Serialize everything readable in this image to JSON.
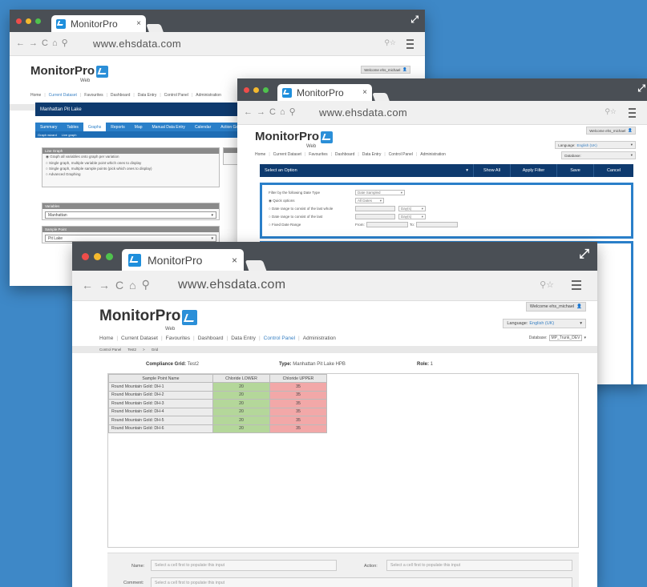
{
  "browser": {
    "tab_title": "MonitorPro",
    "url": "www.ehsdata.com",
    "close_glyph": "×"
  },
  "app": {
    "brand": "MonitorPro",
    "brand_sub": "Web",
    "welcome": "Welcome ehs_michael",
    "language_label": "Language:",
    "language_value": "English (UK)",
    "database_label": "Database:",
    "database_value": "MP_Trunk_DEV",
    "nav": [
      "Home",
      "Current Dataset",
      "Favourites",
      "Dashboard",
      "Data Entry",
      "Control Panel",
      "Administration"
    ]
  },
  "winA": {
    "header": "Manhattan Pit Lake",
    "subtabs": [
      "Summary",
      "Tables",
      "Graphs",
      "Reports",
      "Map",
      "Manual Data Entry",
      "Calendar",
      "Action Gen"
    ],
    "sublinks": [
      "Graph wizard",
      "Live graph"
    ],
    "graph_box_title": "Line Graph",
    "graph_options": [
      "Graph all variables onto graph per variation",
      "Single graph, multiple variable point which ones to display",
      "Single graph, multiple sample points (pick which ones to display)",
      "Advanced Graphing"
    ],
    "variable_label": "Variables",
    "variable_value": "Manhattan",
    "sample_point_label": "Sample Point",
    "sample_point_value": "Pit Lake"
  },
  "winB": {
    "select_option": "Select an Option",
    "buttons": [
      "Show All",
      "Apply Filter",
      "Save",
      "Cancel"
    ],
    "filter_label": "Filter by the following Date Type",
    "filter_value": "Date Sampled",
    "rows": [
      "Quick options",
      "Date range to consist of the last whole",
      "Date range to consist of the last",
      "Fixed Date Range"
    ],
    "quick_value": "All Dates",
    "unit1": "Day(s)",
    "unit2": "Day(s)",
    "from_label": "From:",
    "to_label": "To:"
  },
  "winC": {
    "crumbs": [
      "Control Panel",
      "Test2",
      "Grid"
    ],
    "compliance_label": "Compliance Grid:",
    "compliance_value": "Test2",
    "type_label": "Type:",
    "type_value": "Manhattan Pit Lake HPB",
    "role_label": "Role:",
    "role_value": "1",
    "columns": [
      "Sample Point Name",
      "Chloride LOWER",
      "Chloride UPPER"
    ],
    "rows": [
      [
        "Round Mountain Gold: DH-1",
        "20",
        "35"
      ],
      [
        "Round Mountain Gold: DH-2",
        "20",
        "35"
      ],
      [
        "Round Mountain Gold: DH-3",
        "20",
        "35"
      ],
      [
        "Round Mountain Gold: DH-4",
        "20",
        "35"
      ],
      [
        "Round Mountain Gold: DH-5",
        "20",
        "35"
      ],
      [
        "Round Mountain Gold: DH-6",
        "20",
        "35"
      ]
    ],
    "name_label": "Name:",
    "action_label": "Action:",
    "comment_label": "Comment:",
    "placeholder": "Select a cell first to populate this input"
  },
  "colors": {
    "background": "#3e88c7",
    "titlebar": "#4a4f55",
    "header_navy": "#0e3a6e",
    "accent_blue": "#2a7fc9",
    "lower_green": "#b4d79a",
    "upper_red": "#f2a8a8"
  },
  "icons": [
    "back-arrow-icon",
    "forward-arrow-icon",
    "reload-icon",
    "home-icon",
    "search-icon",
    "zoom-icon",
    "star-icon",
    "hamburger-menu-icon",
    "expand-icon",
    "user-icon"
  ]
}
